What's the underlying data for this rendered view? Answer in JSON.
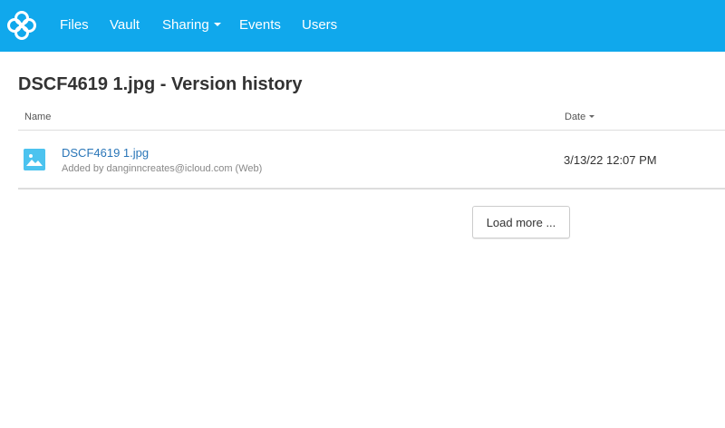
{
  "colors": {
    "navbar_bg": "#10a8ec",
    "link": "#2a76b8",
    "file_icon": "#4cc3ef"
  },
  "navbar": {
    "logo_icon": "sync-logo-icon",
    "items": [
      {
        "label": "Files"
      },
      {
        "label": "Vault"
      },
      {
        "label": "Sharing",
        "has_dropdown": true
      },
      {
        "label": "Events"
      },
      {
        "label": "Users"
      }
    ]
  },
  "page": {
    "file_name": "DSCF4619 1.jpg",
    "title_suffix": " - Version history"
  },
  "table": {
    "columns": {
      "name": "Name",
      "date": "Date",
      "date_sort_icon": "caret-down-icon"
    },
    "rows": [
      {
        "icon": "image-file-icon",
        "name": "DSCF4619 1.jpg",
        "added_by": "Added by danginncreates@icloud.com (Web)",
        "date": "3/13/22 12:07 PM"
      }
    ]
  },
  "load_more": {
    "label": "Load more ..."
  }
}
